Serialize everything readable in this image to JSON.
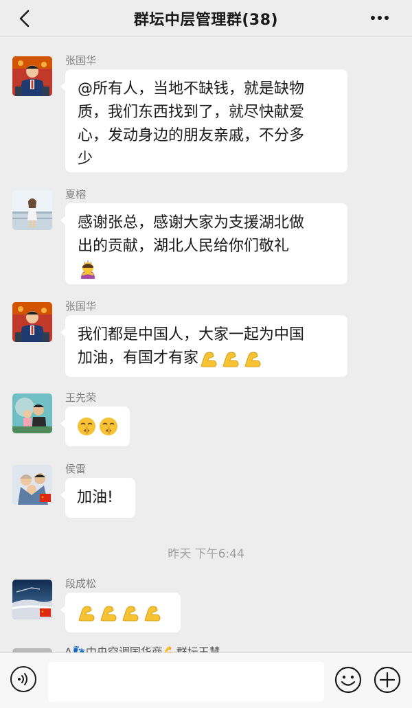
{
  "header": {
    "title": "群坛中层管理群(38)"
  },
  "messages": [
    {
      "sender": "张国华",
      "text": "@所有人，当地不缺钱，就是缺物质，我们东西找到了，就尽快献爱心，发动身边的朋友亲戚，不分多少",
      "lines": [
        "@所有人，当地不缺钱，就是缺物",
        "质，我们东西找到了，就尽快献爱",
        "心，发动身边的朋友亲戚，不分多",
        "少"
      ]
    },
    {
      "sender": "夏榕",
      "lines": [
        "感谢张总，感谢大家为支援湖北做",
        "出的贡献，湖北人民给你们敬礼"
      ],
      "emojis": [
        "bowing-person-emoji"
      ]
    },
    {
      "sender": "张国华",
      "lines": [
        "我们都是中国人，大家一起为中国",
        "加油，有国才有家"
      ],
      "emojis": [
        "flexed-biceps-emoji",
        "flexed-biceps-emoji",
        "flexed-biceps-emoji"
      ]
    },
    {
      "sender": "王先荣",
      "emojis": [
        "shushing-face-emoji",
        "shushing-face-emoji"
      ]
    },
    {
      "sender": "侯雷",
      "text": "加油!"
    },
    {
      "sender": "段成松",
      "emojis": [
        "flexed-biceps-emoji",
        "flexed-biceps-emoji",
        "flexed-biceps-emoji",
        "flexed-biceps-emoji"
      ]
    }
  ],
  "timestamp": "昨天 下午6:44",
  "partial_message": "A👣中央空调国华商💪群坛王慧",
  "footer": {
    "input_value": "",
    "icons": [
      "voice-icon",
      "emoji-icon",
      "plus-icon"
    ]
  },
  "colors": {
    "background": "#ededed",
    "bubble": "#ffffff",
    "sender": "#7f7f7f",
    "emoji_yellow": "#f7c233"
  }
}
